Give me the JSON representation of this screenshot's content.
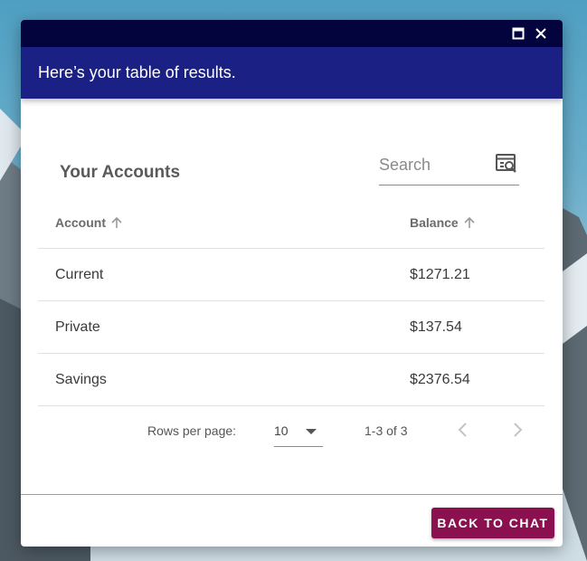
{
  "dialog": {
    "banner_text": "Here’s your table of results."
  },
  "accounts": {
    "title": "Your Accounts",
    "search": {
      "placeholder": "Search"
    },
    "columns": {
      "account": "Account",
      "balance": "Balance"
    },
    "rows": [
      {
        "account": "Current",
        "balance": "$1271.21"
      },
      {
        "account": "Private",
        "balance": "$137.54"
      },
      {
        "account": "Savings",
        "balance": "$2376.54"
      }
    ],
    "pagination": {
      "rows_per_page_label": "Rows per page:",
      "rows_per_page_value": "10",
      "range_text": "1-3 of 3"
    }
  },
  "footer": {
    "back_label": "BACK TO CHAT"
  },
  "colors": {
    "titlebar": "#03043d",
    "banner": "#1b2184",
    "back_button": "#8a1050"
  },
  "icons": {
    "maximize": "maximize-icon",
    "close": "close-icon",
    "search": "search-icon",
    "sort": "arrow-up-icon",
    "dropdown": "caret-down-icon",
    "prev": "chevron-left-icon",
    "next": "chevron-right-icon"
  }
}
